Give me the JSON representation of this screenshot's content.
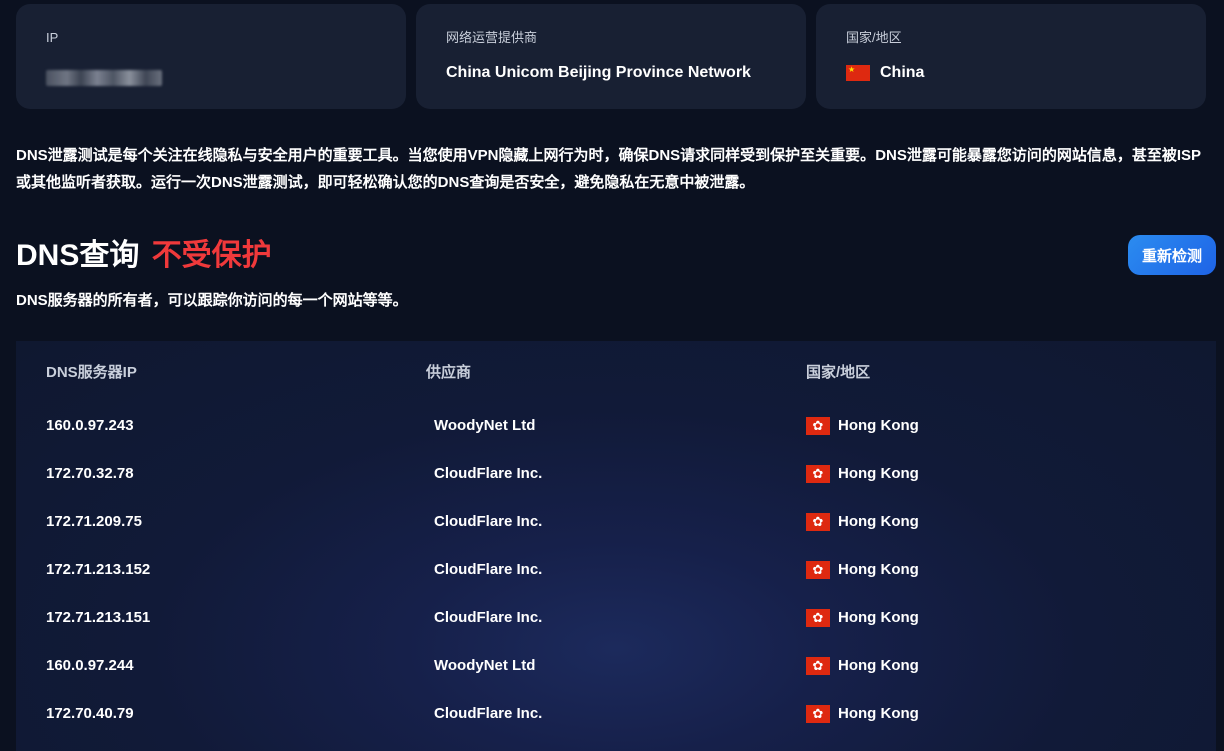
{
  "cards": [
    {
      "label": "IP",
      "value": ""
    },
    {
      "label": "网络运营提供商",
      "value": "China Unicom Beijing Province Network"
    },
    {
      "label": "国家/地区",
      "value": "China",
      "flag": "cn-flag-icon"
    }
  ],
  "intro": "DNS泄露测试是每个关注在线隐私与安全用户的重要工具。当您使用VPN隐藏上网行为时，确保DNS请求同样受到保护至关重要。DNS泄露可能暴露您访问的网站信息，甚至被ISP或其他监听者获取。运行一次DNS泄露测试，即可轻松确认您的DNS查询是否安全，避免隐私在无意中被泄露。",
  "headline": {
    "prefix": "DNS查询",
    "status": "不受保护",
    "status_color": "#f0393b"
  },
  "recheck_label": "重新检测",
  "subline": "DNS服务器的所有者，可以跟踪你访问的每一个网站等等。",
  "table": {
    "headers": [
      "DNS服务器IP",
      "供应商",
      "国家/地区"
    ],
    "rows": [
      {
        "ip": "160.0.97.243",
        "provider": "WoodyNet Ltd",
        "country": "Hong Kong"
      },
      {
        "ip": "172.70.32.78",
        "provider": "CloudFlare Inc.",
        "country": "Hong Kong"
      },
      {
        "ip": "172.71.209.75",
        "provider": "CloudFlare Inc.",
        "country": "Hong Kong"
      },
      {
        "ip": "172.71.213.152",
        "provider": "CloudFlare Inc.",
        "country": "Hong Kong"
      },
      {
        "ip": "172.71.213.151",
        "provider": "CloudFlare Inc.",
        "country": "Hong Kong"
      },
      {
        "ip": "160.0.97.244",
        "provider": "WoodyNet Ltd",
        "country": "Hong Kong"
      },
      {
        "ip": "172.70.40.79",
        "provider": "CloudFlare Inc.",
        "country": "Hong Kong"
      }
    ],
    "flag_icon": "hk-flag-icon",
    "flag_glyph": "✿"
  }
}
